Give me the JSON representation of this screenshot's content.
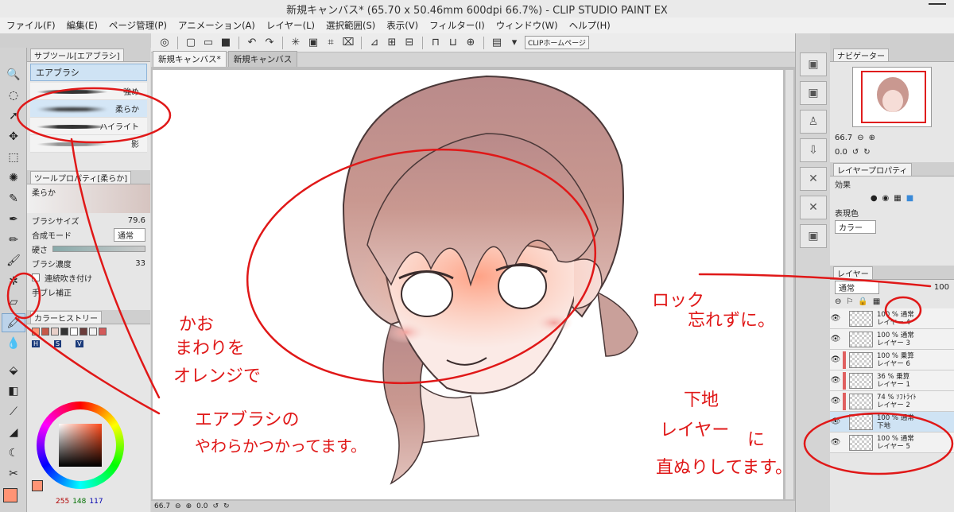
{
  "window": {
    "title": "新規キャンバス* (65.70 x 50.46mm 600dpi 66.7%) - CLIP STUDIO PAINT EX"
  },
  "menu": [
    "ファイル(F)",
    "編集(E)",
    "ページ管理(P)",
    "アニメーション(A)",
    "レイヤー(L)",
    "選択範囲(S)",
    "表示(V)",
    "フィルター(I)",
    "ウィンドウ(W)",
    "ヘルプ(H)"
  ],
  "command_bar": {
    "home_label": "CLIPホームページ"
  },
  "doc_tabs": [
    "新規キャンバス*",
    "新規キャンバス"
  ],
  "subtool_panel": {
    "tab_label": "サブツール[エアブラシ]",
    "group_label": "エアブラシ",
    "brushes": [
      "強め",
      "柔らか",
      "ハイライト",
      "影"
    ]
  },
  "tool_property": {
    "tab_label": "ツールプロパティ[柔らか]",
    "preset_name": "柔らか",
    "brush_size_label": "ブラシサイズ",
    "brush_size_value": "79.6",
    "blend_mode_label": "合成モード",
    "blend_mode_value": "通常",
    "hardness_label": "硬さ",
    "density_label": "ブラシ濃度",
    "density_value": "33",
    "continuous_label": "連続吹き付け",
    "stabilization_label": "手ブレ補正"
  },
  "color_history": {
    "tab_label": "カラーヒストリー"
  },
  "color_values": {
    "h_label": "H",
    "s_label": "S",
    "v_label": "V",
    "r": "255",
    "g": "148",
    "b": "117"
  },
  "statusbar": {
    "zoom": "66.7",
    "angle": "0.0"
  },
  "navigator": {
    "tab_label": "ナビゲーター",
    "zoom": "66.7",
    "angle": "0.0"
  },
  "layer_property": {
    "tab_label": "レイヤープロパティ",
    "effect_label": "効果",
    "expression_label": "表現色",
    "expression_value": "カラー"
  },
  "layer_panel": {
    "tab_label": "レイヤー",
    "blend_mode": "通常",
    "opacity": "100",
    "layers": [
      {
        "info": "100 % 通常",
        "name": "レイヤー 4",
        "mark": ""
      },
      {
        "info": "100 % 通常",
        "name": "レイヤー 3",
        "mark": ""
      },
      {
        "info": "100 % 乗算",
        "name": "レイヤー 6",
        "mark": "#e06060"
      },
      {
        "info": "36 % 乗算",
        "name": "レイヤー 1",
        "mark": "#e06060"
      },
      {
        "info": "74 % ｿﾌﾄﾗｲﾄ",
        "name": "レイヤー 2",
        "mark": "#e06060"
      },
      {
        "info": "100 % 通常",
        "name": "下地",
        "mark": ""
      },
      {
        "info": "100 % 通常",
        "name": "レイヤー 5",
        "mark": ""
      }
    ]
  },
  "annotations": {
    "kao_line1": "かお",
    "kao_line2": "まわりを",
    "kao_line3": "オレンジで",
    "airbrush_line1": "エアブラシの",
    "airbrush_line2": "やわらかつかってます。",
    "lock_line1": "ロック",
    "lock_line2": "忘れずに。",
    "base_line1": "下地",
    "base_line2": "レイヤー",
    "base_line3": "に",
    "base_line4": "直ぬりしてます。"
  },
  "colors": {
    "annotation_red": "#e01818",
    "selection_blue": "#cfe3f4",
    "main_color": "#ff9475"
  }
}
